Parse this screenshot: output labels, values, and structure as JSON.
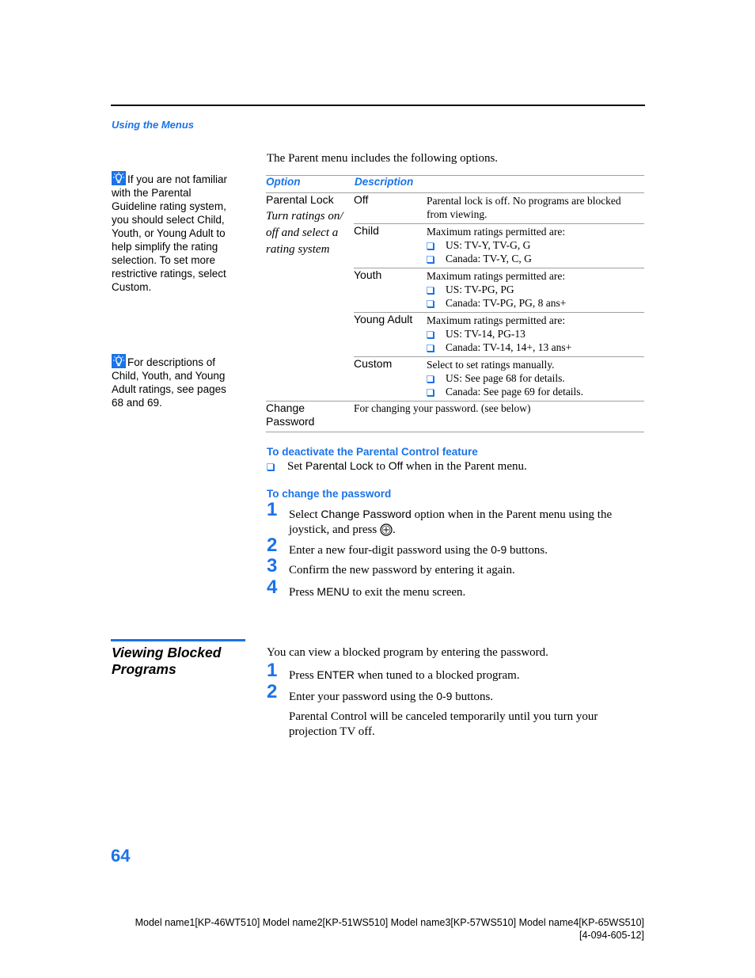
{
  "header": {
    "section_label": "Using the Menus"
  },
  "sidebar": {
    "tips": [
      {
        "icon": "lightbulb-tip-icon",
        "text": "If you are not familiar with the Parental Guideline rating system, you should select Child, Youth, or Young Adult to help simplify the rating selection. To set more restrictive ratings, select Custom."
      },
      {
        "icon": "lightbulb-tip-icon",
        "text": "For descriptions of Child, Youth, and Young Adult ratings, see pages 68 and 69."
      }
    ],
    "section_heading": "Viewing Blocked Programs"
  },
  "main": {
    "intro": "The Parent menu includes the following options.",
    "table": {
      "headers": [
        "Option",
        "Description"
      ],
      "parental_lock": {
        "option": "Parental Lock",
        "note": "Turn ratings on/ off and select a rating system",
        "rows": [
          {
            "setting": "Off",
            "lines": [
              "Parental lock is off. No programs are blocked from viewing."
            ],
            "bullets": []
          },
          {
            "setting": "Child",
            "lines": [
              "Maximum ratings permitted are:"
            ],
            "bullets": [
              "US: TV-Y, TV-G, G",
              "Canada: TV-Y, C, G"
            ]
          },
          {
            "setting": "Youth",
            "lines": [
              "Maximum ratings permitted are:"
            ],
            "bullets": [
              "US: TV-PG, PG",
              "Canada: TV-PG, PG, 8 ans+"
            ]
          },
          {
            "setting": "Young Adult",
            "lines": [
              "Maximum ratings permitted are:"
            ],
            "bullets": [
              "US: TV-14, PG-13",
              "Canada: TV-14, 14+, 13 ans+"
            ]
          },
          {
            "setting": "Custom",
            "lines": [
              "Select to set ratings manually."
            ],
            "bullets": [
              "US: See page 68 for details.",
              "Canada: See page 69 for details."
            ]
          }
        ]
      },
      "change_password": {
        "option_line1": "Change",
        "option_line2": "Password",
        "description": "For changing your password. (see below)"
      }
    },
    "deactivate": {
      "heading": "To deactivate the Parental Control feature",
      "bullet_pre": "Set ",
      "bullet_kw1": "Parental Lock",
      "bullet_mid": " to ",
      "bullet_kw2": "Off",
      "bullet_post": " when in the Parent menu."
    },
    "change_password": {
      "heading": "To change the password",
      "steps": [
        {
          "num": "1",
          "pre": "Select ",
          "kw": "Change Password",
          "post": " option when in the Parent menu using the joystick, and press",
          "end": "."
        },
        {
          "num": "2",
          "pre": "Enter a new four-digit password using the ",
          "kw": "0-9",
          "post": " buttons."
        },
        {
          "num": "3",
          "pre": "Confirm the new password by entering it again.",
          "kw": "",
          "post": ""
        },
        {
          "num": "4",
          "pre": "Press ",
          "kw": "MENU",
          "post": " to exit the menu screen."
        }
      ]
    },
    "viewing_blocked": {
      "intro": "You can view a blocked program by entering the password.",
      "steps": [
        {
          "num": "1",
          "pre": "Press ",
          "kw": "ENTER",
          "post": " when tuned to a blocked program."
        },
        {
          "num": "2",
          "pre": "Enter your password using the ",
          "kw": "0-9",
          "post": " buttons."
        }
      ],
      "note": "Parental Control will be canceled temporarily until you turn your projection TV off."
    }
  },
  "footer": {
    "page_number": "64",
    "models": "Model name1[KP-46WT510] Model name2[KP-51WS510] Model name3[KP-57WS510] Model name4[KP-65WS510]",
    "part_number": "[4-094-605-12]"
  },
  "colors": {
    "accent": "#1a73e8",
    "rule": "#000000",
    "table_line": "#a0a0a0"
  }
}
